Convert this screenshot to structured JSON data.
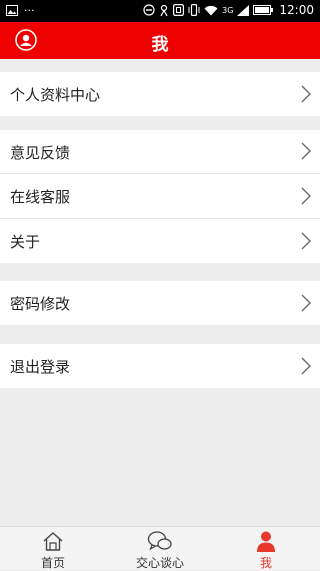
{
  "status_bar": {
    "left_icons": [
      "image-icon",
      "more-dots-icon"
    ],
    "dots": "···",
    "network_label": "3G",
    "time": "12:00"
  },
  "header": {
    "title": "我"
  },
  "menu": {
    "profile_center": "个人资料中心",
    "feedback": "意见反馈",
    "online_service": "在线客服",
    "about": "关于",
    "change_password": "密码修改",
    "logout": "退出登录"
  },
  "bottom_nav": {
    "items": [
      {
        "label": "首页",
        "icon": "home-icon"
      },
      {
        "label": "交心谈心",
        "icon": "chat-bubbles-icon"
      },
      {
        "label": "我",
        "icon": "person-icon",
        "active": true
      }
    ]
  },
  "colors": {
    "header": "#ee0000",
    "active_tab": "#e8372c",
    "background": "#ededed"
  }
}
